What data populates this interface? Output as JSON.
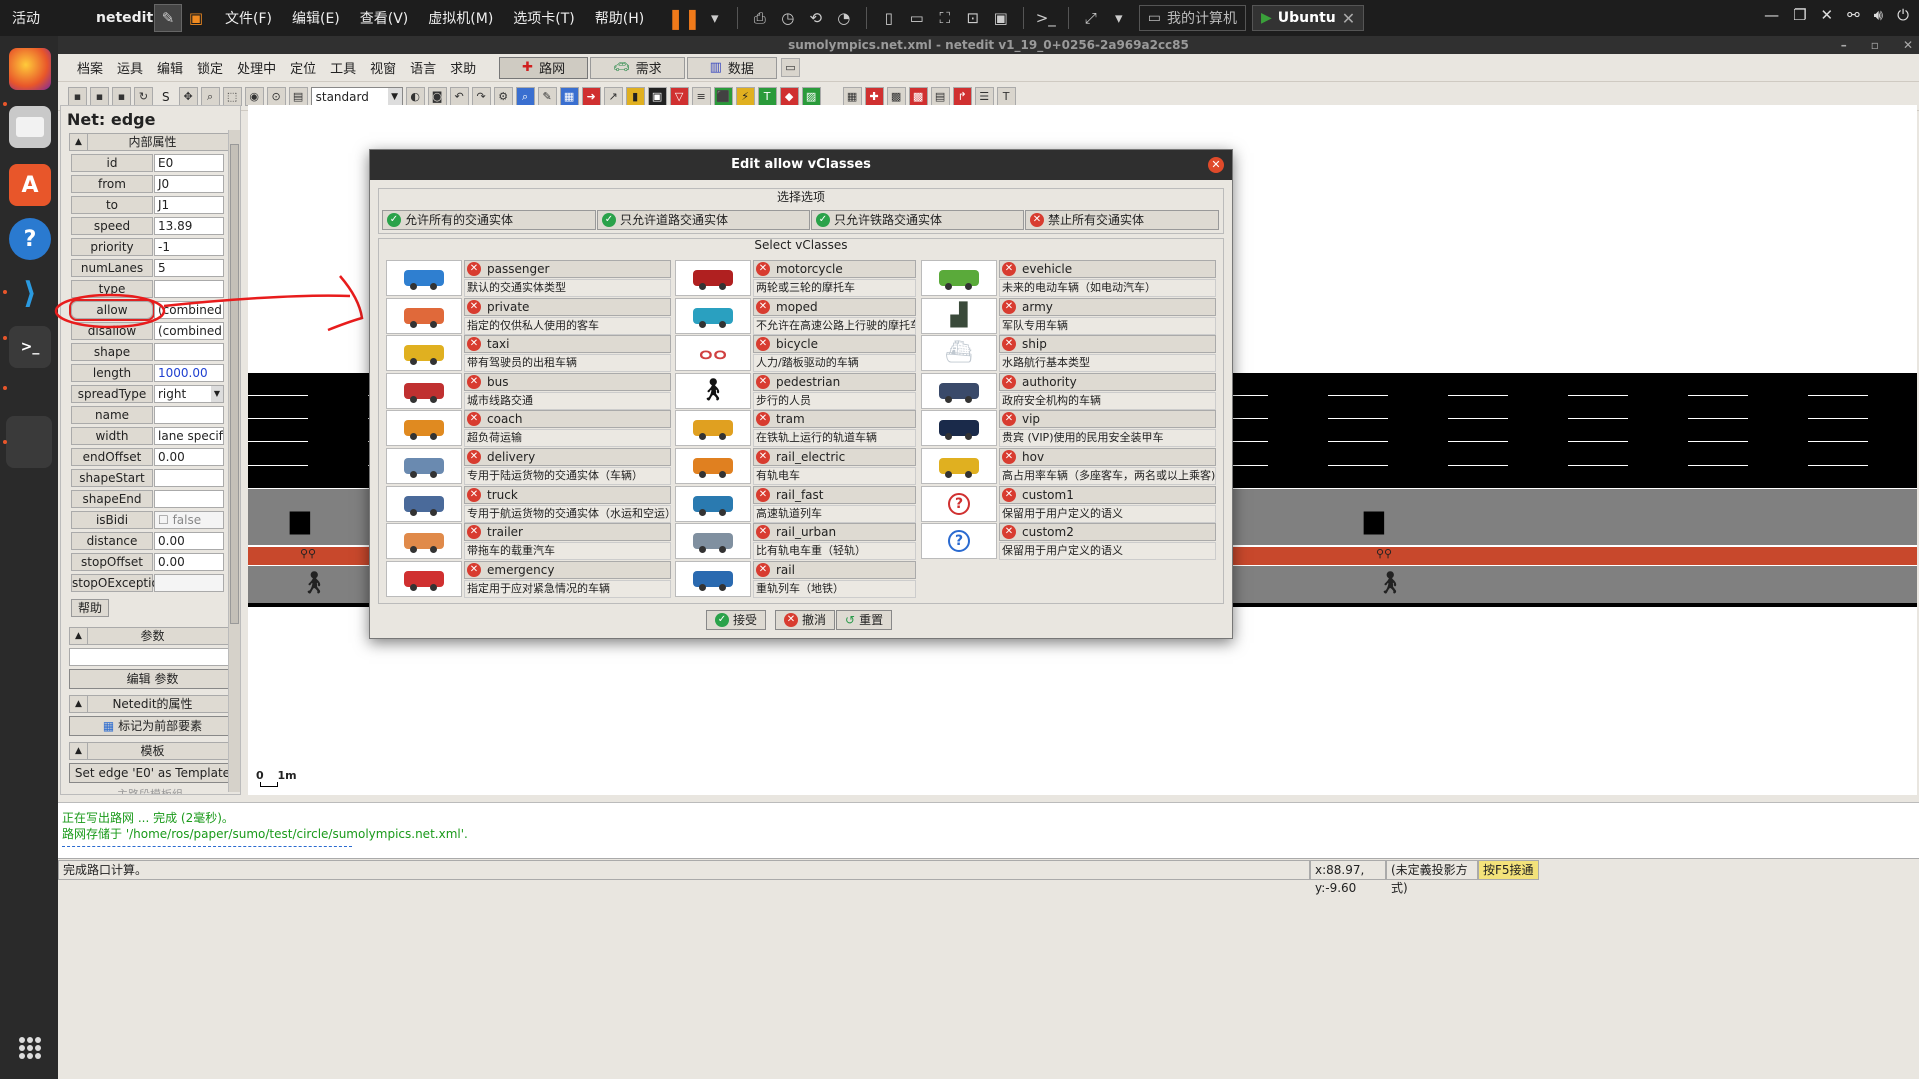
{
  "host": {
    "activities": "活动",
    "app_name": "netedit",
    "menu": [
      "文件(F)",
      "编辑(E)",
      "查看(V)",
      "虚拟机(M)",
      "选项卡(T)",
      "帮助(H)"
    ],
    "tabs": [
      {
        "label": "我的计算机"
      },
      {
        "label": "Ubuntu"
      }
    ]
  },
  "window": {
    "title": "sumolympics.net.xml - netedit v1_19_0+0256-2a969a2cc85",
    "menu": [
      "档案",
      "运具",
      "编辑",
      "锁定",
      "处理中",
      "定位",
      "工具",
      "视窗",
      "语言",
      "求助"
    ],
    "modes": [
      {
        "label": "路网",
        "active": true
      },
      {
        "label": "需求",
        "active": false
      },
      {
        "label": "数据",
        "active": false
      }
    ],
    "scheme": "standard",
    "scheme_prefix": "S"
  },
  "panel": {
    "title": "Net: edge",
    "internal_section": "内部属性",
    "attributes": [
      {
        "label": "id",
        "value": "E0"
      },
      {
        "label": "from",
        "value": "J0"
      },
      {
        "label": "to",
        "value": "J1"
      },
      {
        "label": "speed",
        "value": "13.89"
      },
      {
        "label": "priority",
        "value": "-1"
      },
      {
        "label": "numLanes",
        "value": "5"
      },
      {
        "label": "type",
        "value": ""
      },
      {
        "label": "allow",
        "value": "(combined!)"
      },
      {
        "label": "disallow",
        "value": "(combined!)"
      },
      {
        "label": "shape",
        "value": ""
      },
      {
        "label": "length",
        "value": "1000.00"
      },
      {
        "label": "spreadType",
        "value": "right"
      },
      {
        "label": "name",
        "value": ""
      },
      {
        "label": "width",
        "value": "lane specific"
      },
      {
        "label": "endOffset",
        "value": "0.00"
      },
      {
        "label": "shapeStart",
        "value": ""
      },
      {
        "label": "shapeEnd",
        "value": ""
      },
      {
        "label": "isBidi",
        "value": "false"
      },
      {
        "label": "distance",
        "value": "0.00"
      },
      {
        "label": "stopOffset",
        "value": "0.00"
      },
      {
        "label": "stopOException",
        "value": ""
      }
    ],
    "help_button": "帮助",
    "params_section": "参数",
    "edit_params_button": "编辑 参数",
    "netedit_section": "Netedit的属性",
    "front_button": "标记为前部要素",
    "template_section": "模板",
    "template_button": "Set edge 'E0' as Template",
    "cut_label": "主路段模板组"
  },
  "scale": {
    "zero": "0",
    "unit": "1m"
  },
  "messages": [
    "正在写出路网 ... 完成 (2毫秒)。",
    "路网存储于 '/home/ros/paper/sumo/test/circle/sumolympics.net.xml'."
  ],
  "status": {
    "left": "完成路口计算。",
    "coords": "x:88.97, y:-9.60",
    "proj": "(未定義投影方式)",
    "hint": "按F5接通"
  },
  "dialog": {
    "title": "Edit allow vClasses",
    "options_group": "选择选项",
    "options": [
      "允许所有的交通实体",
      "只允许道路交通实体",
      "只允许铁路交通实体",
      "禁止所有交通实体"
    ],
    "vclasses_group": "Select vClasses",
    "columns": [
      [
        {
          "name": "passenger",
          "desc": "默认的交通实体类型",
          "color": "#2f7fd0"
        },
        {
          "name": "private",
          "desc": "指定的仅供私人使用的客车",
          "color": "#e0693a"
        },
        {
          "name": "taxi",
          "desc": "带有驾驶员的出租车辆",
          "color": "#e0b020"
        },
        {
          "name": "bus",
          "desc": "城市线路交通",
          "color": "#c03030"
        },
        {
          "name": "coach",
          "desc": "超负荷运输",
          "color": "#e08a20"
        },
        {
          "name": "delivery",
          "desc": "专用于陆运货物的交通实体（车辆）",
          "color": "#6a8ab0"
        },
        {
          "name": "truck",
          "desc": "专用于航运货物的交通实体（水运和空运）",
          "color": "#4a6a9a"
        },
        {
          "name": "trailer",
          "desc": "带拖车的载重汽车",
          "color": "#e08a4a"
        },
        {
          "name": "emergency",
          "desc": "指定用于应对紧急情况的车辆",
          "color": "#d03030"
        }
      ],
      [
        {
          "name": "motorcycle",
          "desc": "两轮或三轮的摩托车",
          "color": "#b02020"
        },
        {
          "name": "moped",
          "desc": "不允许在高速公路上行驶的摩托车",
          "color": "#2aa0c0"
        },
        {
          "name": "bicycle",
          "desc": "人力/踏板驱动的车辆",
          "color": "#d04040"
        },
        {
          "name": "pedestrian",
          "desc": "步行的人员",
          "color": "#111111"
        },
        {
          "name": "tram",
          "desc": "在铁轨上运行的轨道车辆",
          "color": "#e0a020"
        },
        {
          "name": "rail_electric",
          "desc": "有轨电车",
          "color": "#e08020"
        },
        {
          "name": "rail_fast",
          "desc": "高速轨道列车",
          "color": "#2a7ab0"
        },
        {
          "name": "rail_urban",
          "desc": "比有轨电车重（轻轨）",
          "color": "#8090a0"
        },
        {
          "name": "rail",
          "desc": "重轨列车（地铁）",
          "color": "#2a6ab0"
        }
      ],
      [
        {
          "name": "evehicle",
          "desc": "未来的电动车辆（如电动汽车）",
          "color": "#5aaa3a"
        },
        {
          "name": "army",
          "desc": "军队专用车辆",
          "color": "#3a4a3a"
        },
        {
          "name": "ship",
          "desc": "水路航行基本类型",
          "color": "#c0c8d0"
        },
        {
          "name": "authority",
          "desc": "政府安全机构的车辆",
          "color": "#3a4a6a"
        },
        {
          "name": "vip",
          "desc": "贵宾 (VIP)使用的民用安全装甲车",
          "color": "#1a2a4a"
        },
        {
          "name": "hov",
          "desc": "高占用率车辆（多座客车，两名或以上乘客)",
          "color": "#e0b020"
        },
        {
          "name": "custom1",
          "desc": "保留用于用户定义的语义",
          "color": "#d03030"
        },
        {
          "name": "custom2",
          "desc": "保留用于用户定义的语义",
          "color": "#2a6ad0"
        }
      ]
    ],
    "accept": "接受",
    "cancel": "撤消",
    "reset": "重置"
  }
}
